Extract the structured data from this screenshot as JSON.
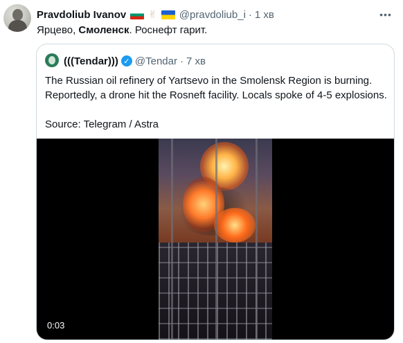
{
  "tweet": {
    "author_name": "Pravdoliub Ivanov",
    "flag_left": "bulgaria-flag",
    "emoji": "victory-hand",
    "flag_right": "ukraine-flag",
    "handle": "@pravdoliub_i",
    "separator": "·",
    "time": "1 хв",
    "text_part1": "Ярцево, ",
    "text_bold": "Смоленск",
    "text_part2": ". Роснефт гарит.",
    "more_icon": "more-horizontal-icon"
  },
  "quoted": {
    "author_name": "(((Tendar)))",
    "verified_icon": "verified-badge-icon",
    "handle": "@Tendar",
    "separator": "·",
    "time": "7 хв",
    "lines": [
      "The Russian oil refinery of Yartsevo in the Smolensk Region is burning.",
      "Reportedly, a drone hit the Rosneft facility. Locals spoke of 4-5 explosions."
    ],
    "source": "Source: Telegram / Astra",
    "video": {
      "timestamp": "0:03"
    }
  },
  "colors": {
    "text_primary": "#0f1419",
    "text_secondary": "#536471",
    "verified": "#1d9bf0",
    "border": "#cfd9de"
  }
}
